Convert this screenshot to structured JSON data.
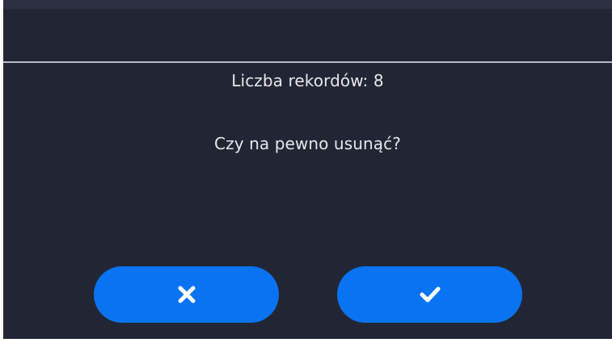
{
  "dialog": {
    "record_count_text": "Liczba rekordów: 8",
    "question_text": "Czy na pewno usunąć?"
  },
  "buttons": {
    "cancel_icon": "close-icon",
    "confirm_icon": "check-icon"
  },
  "colors": {
    "background": "#222634",
    "button": "#0a73f2",
    "text": "#e6e7eb",
    "divider": "#b9bcc6"
  }
}
